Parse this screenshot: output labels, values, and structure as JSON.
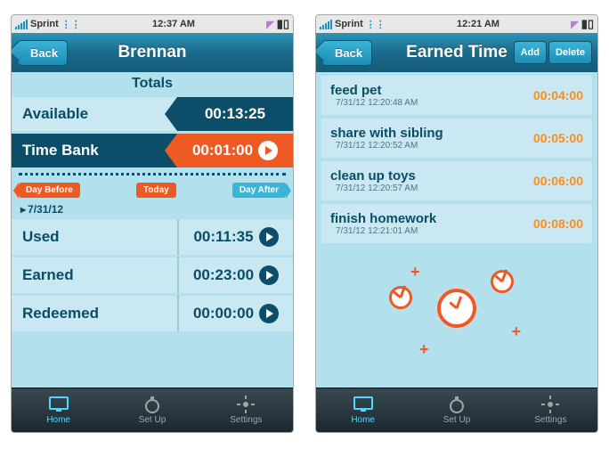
{
  "left": {
    "status": {
      "carrier": "Sprint",
      "time": "12:37 AM"
    },
    "nav": {
      "back": "Back",
      "title": "Brennan"
    },
    "totals_header": "Totals",
    "available": {
      "label": "Available",
      "value": "00:13:25"
    },
    "bank": {
      "label": "Time Bank",
      "value": "00:01:00"
    },
    "daynav": {
      "before": "Day Before",
      "today": "Today",
      "after": "Day After"
    },
    "date": "7/31/12",
    "rows": [
      {
        "label": "Used",
        "value": "00:11:35"
      },
      {
        "label": "Earned",
        "value": "00:23:00"
      },
      {
        "label": "Redeemed",
        "value": "00:00:00"
      }
    ],
    "tabs": {
      "home": "Home",
      "setup": "Set Up",
      "settings": "Settings"
    }
  },
  "right": {
    "status": {
      "carrier": "Sprint",
      "time": "12:21 AM"
    },
    "nav": {
      "back": "Back",
      "title": "Earned Time",
      "add": "Add",
      "delete": "Delete"
    },
    "items": [
      {
        "title": "feed pet",
        "sub": "7/31/12 12:20:48 AM",
        "time": "00:04:00"
      },
      {
        "title": "share with sibling",
        "sub": "7/31/12 12:20:52 AM",
        "time": "00:05:00"
      },
      {
        "title": "clean up toys",
        "sub": "7/31/12 12:20:57 AM",
        "time": "00:06:00"
      },
      {
        "title": "finish homework",
        "sub": "7/31/12 12:21:01 AM",
        "time": "00:08:00"
      }
    ],
    "tabs": {
      "home": "Home",
      "setup": "Set Up",
      "settings": "Settings"
    }
  }
}
